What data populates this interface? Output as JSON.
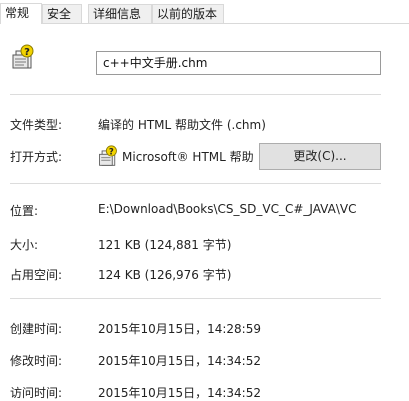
{
  "tabs": [
    {
      "label": "常规"
    },
    {
      "label": "安全"
    },
    {
      "label": "详细信息"
    },
    {
      "label": "以前的版本"
    }
  ],
  "file": {
    "name": "c++中文手册.chm",
    "icon": "chm-file-icon"
  },
  "type": {
    "label": "文件类型:",
    "value": "编译的 HTML 帮助文件 (.chm)"
  },
  "open_with": {
    "label": "打开方式:",
    "app": "Microsoft® HTML 帮助",
    "button": "更改(C)..."
  },
  "location": {
    "label": "位置:",
    "value": "E:\\Download\\Books\\CS_SD_VC_C#_JAVA\\VC"
  },
  "size": {
    "label": "大小:",
    "value": "121 KB (124,881 字节)"
  },
  "size_on_disk": {
    "label": "占用空间:",
    "value": "124 KB (126,976 字节)"
  },
  "created": {
    "label": "创建时间:",
    "value": "2015年10月15日，14:28:59"
  },
  "modified": {
    "label": "修改时间:",
    "value": "2015年10月15日，14:34:52"
  },
  "accessed": {
    "label": "访问时间:",
    "value": "2015年10月15日，14:34:52"
  }
}
